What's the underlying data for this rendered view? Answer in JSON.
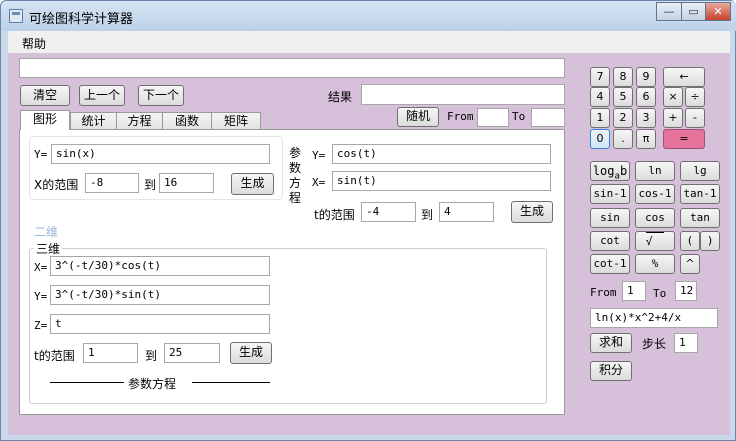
{
  "window": {
    "title": "可绘图科学计算器",
    "minimize": "—",
    "maximize": "▭",
    "close": "✕"
  },
  "menu": {
    "help": "帮助"
  },
  "toolbar": {
    "clear": "清空",
    "prev": "上一个",
    "next": "下一个",
    "result_label": "结果",
    "random": "随机",
    "from_label": "From",
    "to_label": "To"
  },
  "tabs": [
    "图形",
    "统计",
    "方程",
    "函数",
    "矩阵"
  ],
  "graph2d": {
    "y_label": "Y=",
    "y_expr": "sin(x)",
    "x_range_label": "X的范围",
    "from": "-8",
    "to_label": "到",
    "to": "16",
    "generate": "生成"
  },
  "param2d": {
    "title_chars": [
      "参",
      "数",
      "方",
      "程"
    ],
    "y_label": "Y=",
    "y_expr": "cos(t)",
    "x_label": "X=",
    "x_expr": "sin(t)",
    "t_range_label": "t的范围",
    "from": "-4",
    "to_label": "到",
    "to": "4",
    "generate": "生成"
  },
  "group_2d": "二维",
  "graph3d": {
    "group_label": "三维",
    "x_label": "X=",
    "x_expr": "3^(-t/30)*cos(t)",
    "y_label": "Y=",
    "y_expr": "3^(-t/30)*sin(t)",
    "z_label": "Z=",
    "z_expr": "t",
    "t_range_label": "t的范围",
    "from": "1",
    "to_label": "到",
    "to": "25",
    "generate": "生成",
    "caption": "参数方程"
  },
  "keypad": {
    "digits": [
      "7",
      "8",
      "9",
      "4",
      "5",
      "6",
      "1",
      "2",
      "3",
      "0",
      ".",
      "π"
    ],
    "ops": [
      "←",
      "×",
      "÷",
      "+",
      "-",
      "="
    ],
    "functions": [
      "ln",
      "lg",
      "sin-1",
      "cos-1",
      "tan-1",
      "sin",
      "cos",
      "tan",
      "cot",
      "(",
      ")",
      "cot-1",
      "%",
      "^"
    ],
    "log_main": "log",
    "log_sub": "a",
    "log_end": "b",
    "sqrt": "√"
  },
  "integral": {
    "from_label": "From",
    "from": "1",
    "to_label": "To",
    "to": "12",
    "expr": "ln(x)*x^2+4/x",
    "sum": "求和",
    "step_label": "步长",
    "step": "1",
    "integrate": "积分"
  },
  "colors": {
    "client": "#d7c0d9",
    "equals_key": "#e7749c",
    "zero_key_border": "#3c7fd0"
  }
}
